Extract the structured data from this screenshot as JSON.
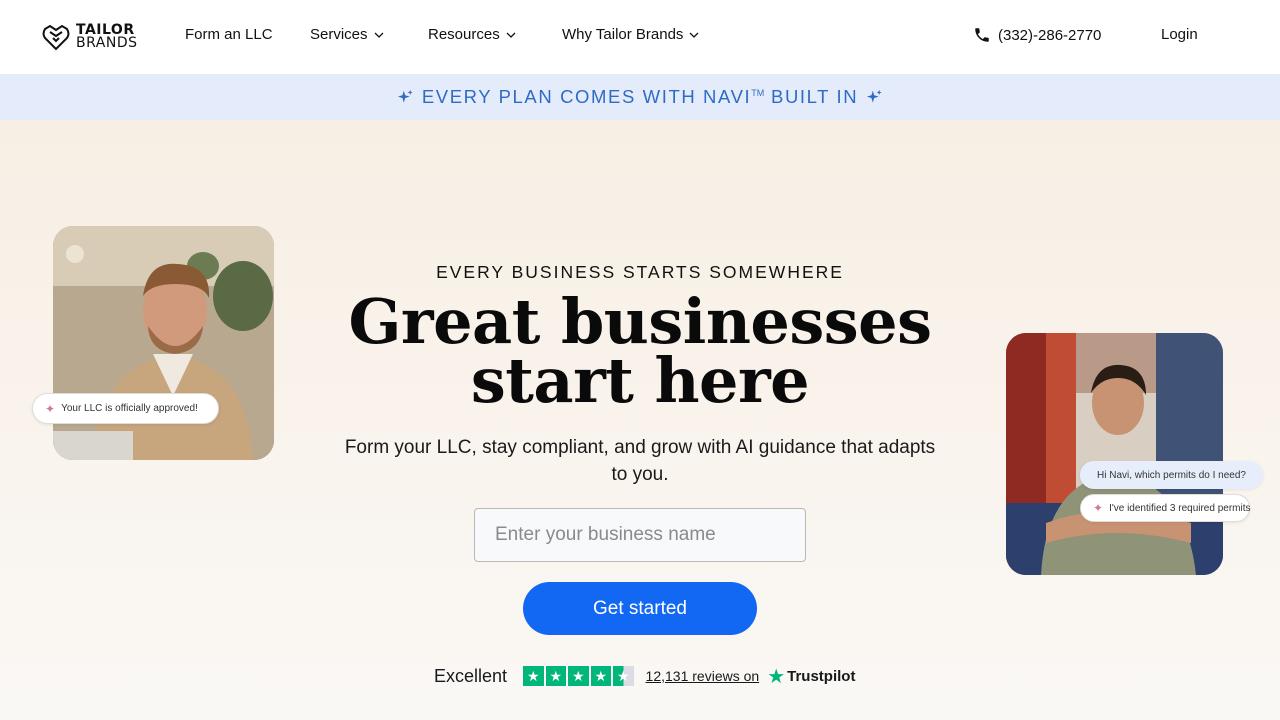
{
  "header": {
    "logo": {
      "line1": "TAILOR",
      "line2": "BRANDS"
    },
    "nav": [
      {
        "label": "Form an LLC",
        "has_dropdown": false
      },
      {
        "label": "Services",
        "has_dropdown": true
      },
      {
        "label": "Resources",
        "has_dropdown": true
      },
      {
        "label": "Why Tailor Brands",
        "has_dropdown": true
      }
    ],
    "phone": "(332)-286-2770",
    "login": "Login"
  },
  "banner": {
    "text": "EVERY PLAN COMES WITH NAVI",
    "tm": "TM",
    "text_end": "BUILT IN",
    "color": "#2f6bc4"
  },
  "hero": {
    "eyebrow": "EVERY BUSINESS STARTS SOMEWHERE",
    "headline_line1": "Great businesses",
    "headline_line2": "start here",
    "subheading": "Form your LLC, stay compliant, and grow with AI guidance that adapts to you.",
    "input_placeholder": "Enter your business name",
    "cta": "Get started",
    "cta_color": "#1268f3",
    "left_chip": "Your LLC is officially approved!",
    "right_chip_question": "Hi Navi, which permits do I need?",
    "right_chip_answer": "I've identified 3 required permits"
  },
  "trustpilot": {
    "rating_text": "Excellent",
    "rating": 4.5,
    "reviews": "12,131 reviews on",
    "brand": "Trustpilot",
    "color": "#00b67a"
  }
}
